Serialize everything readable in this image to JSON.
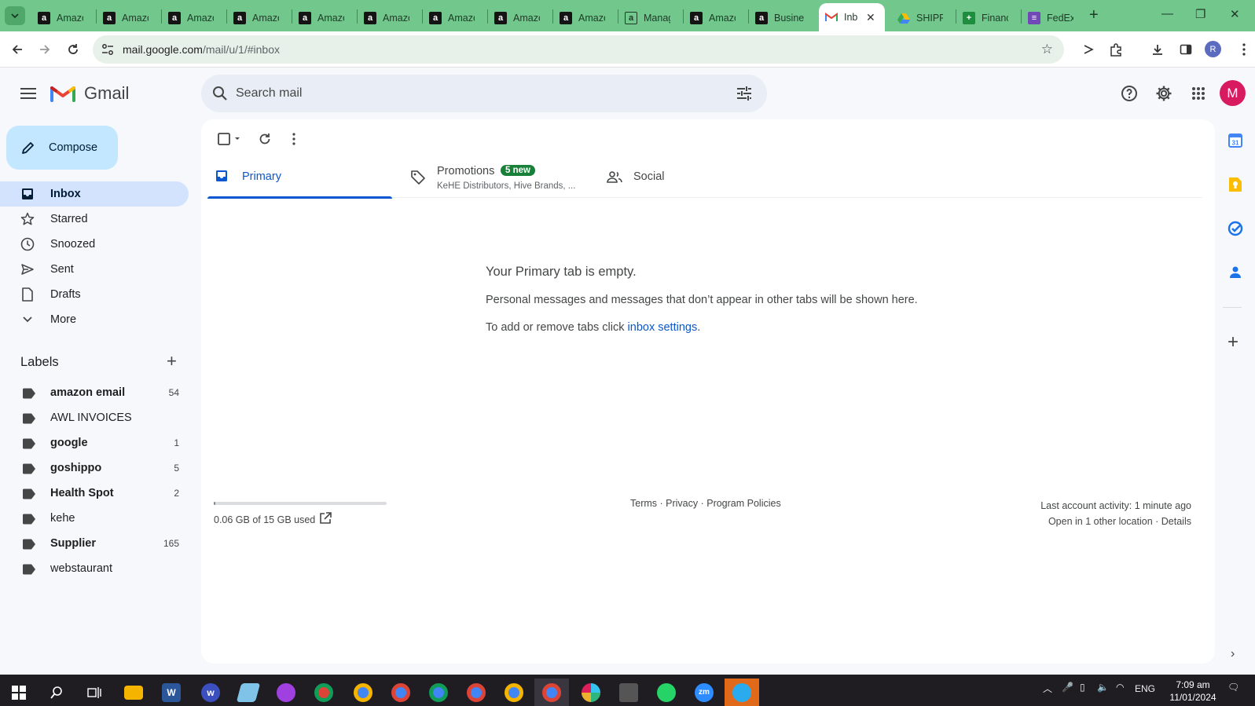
{
  "browser": {
    "tabs": [
      {
        "title": "Amazo",
        "favicon": "amazon-icon"
      },
      {
        "title": "Amazo",
        "favicon": "amazon-icon"
      },
      {
        "title": "Amazo",
        "favicon": "amazon-icon"
      },
      {
        "title": "Amazo",
        "favicon": "amazon-icon"
      },
      {
        "title": "Amazo",
        "favicon": "amazon-icon"
      },
      {
        "title": "Amazo",
        "favicon": "amazon-icon"
      },
      {
        "title": "Amazo",
        "favicon": "amazon-icon"
      },
      {
        "title": "Amazo",
        "favicon": "amazon-icon"
      },
      {
        "title": "Amazo",
        "favicon": "amazon-icon"
      },
      {
        "title": "Manag",
        "favicon": "manage-icon"
      },
      {
        "title": "Amazo",
        "favicon": "amazon-icon"
      },
      {
        "title": "Busine",
        "favicon": "amazon-icon"
      },
      {
        "title": "Inb",
        "favicon": "gmail-icon",
        "active": true
      },
      {
        "title": "SHIPP",
        "favicon": "drive-icon"
      },
      {
        "title": "Financ",
        "favicon": "sheets-icon"
      },
      {
        "title": "FedEx",
        "favicon": "forms-icon"
      }
    ],
    "url_host": "mail.google.com",
    "url_path": "/mail/u/1/#inbox",
    "profile_initial": "R",
    "accent": "#71c78c"
  },
  "gmail": {
    "brand": "Gmail",
    "search_placeholder": "Search mail",
    "avatar_initial": "M",
    "compose_label": "Compose",
    "nav": [
      {
        "label": "Inbox",
        "icon": "inbox-icon",
        "active": true
      },
      {
        "label": "Starred",
        "icon": "star-icon"
      },
      {
        "label": "Snoozed",
        "icon": "clock-icon"
      },
      {
        "label": "Sent",
        "icon": "send-icon"
      },
      {
        "label": "Drafts",
        "icon": "draft-icon"
      },
      {
        "label": "More",
        "icon": "chevron-down-icon"
      }
    ],
    "labels_title": "Labels",
    "labels": [
      {
        "name": "amazon email",
        "count": "54",
        "bold": true
      },
      {
        "name": "AWL INVOICES",
        "count": "",
        "bold": false
      },
      {
        "name": "google",
        "count": "1",
        "bold": true
      },
      {
        "name": "goshippo",
        "count": "5",
        "bold": true
      },
      {
        "name": "Health Spot",
        "count": "2",
        "bold": true
      },
      {
        "name": "kehe",
        "count": "",
        "bold": false
      },
      {
        "name": "Supplier",
        "count": "165",
        "bold": true
      },
      {
        "name": "webstaurant",
        "count": "",
        "bold": false
      }
    ],
    "category_tabs": {
      "primary": "Primary",
      "promotions": "Promotions",
      "promotions_badge": "5 new",
      "promotions_sub": "KeHE Distributors, Hive Brands, ...",
      "social": "Social"
    },
    "empty": {
      "title": "Your Primary tab is empty.",
      "text": "Personal messages and messages that don’t appear in other tabs will be shown here.",
      "text2_prefix": "To add or remove tabs click ",
      "text2_link": "inbox settings",
      "text2_suffix": "."
    },
    "storage": {
      "text": "0.06 GB of 15 GB used",
      "used_fraction": 0.004
    },
    "footer": {
      "terms": "Terms",
      "privacy": "Privacy",
      "policies": "Program Policies",
      "sep": " · "
    },
    "activity": {
      "line1": "Last account activity: 1 minute ago",
      "line2_prefix": "Open in 1 other location · ",
      "details": "Details"
    }
  },
  "taskbar": {
    "lang": "ENG",
    "time": "7:09 am",
    "date": "11/01/2024"
  }
}
